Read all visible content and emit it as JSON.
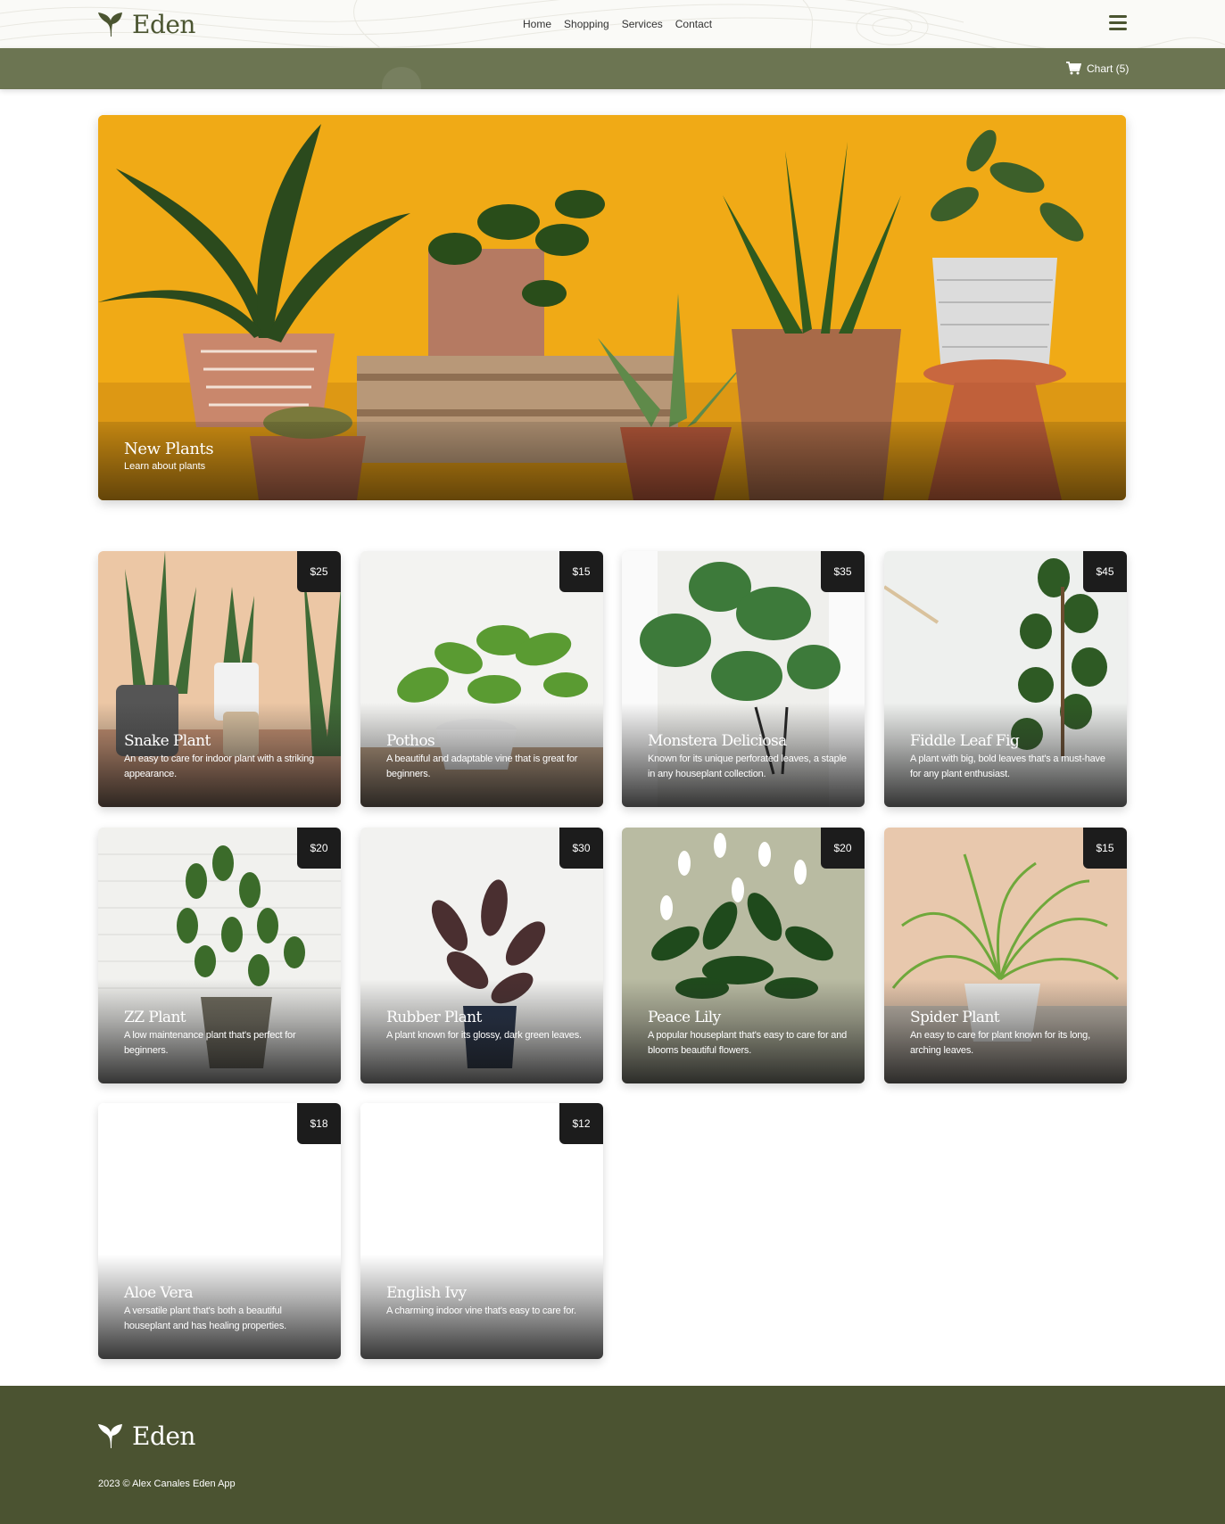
{
  "brand": {
    "name": "Eden"
  },
  "nav": {
    "items": [
      {
        "label": "Home"
      },
      {
        "label": "Shopping"
      },
      {
        "label": "Services"
      },
      {
        "label": "Contact"
      }
    ]
  },
  "cart": {
    "label": "Chart (5)"
  },
  "hero": {
    "title": "New Plants",
    "subtitle": "Learn about plants"
  },
  "products": [
    {
      "name": "Snake Plant",
      "price": "$25",
      "description": "An easy to care for indoor plant with a striking appearance."
    },
    {
      "name": "Pothos",
      "price": "$15",
      "description": "A beautiful and adaptable vine that is great for beginners."
    },
    {
      "name": "Monstera Deliciosa",
      "price": "$35",
      "description": "Known for its unique perforated leaves, a staple in any houseplant collection."
    },
    {
      "name": "Fiddle Leaf Fig",
      "price": "$45",
      "description": "A plant with big, bold leaves that's a must-have for any plant enthusiast."
    },
    {
      "name": "ZZ Plant",
      "price": "$20",
      "description": "A low maintenance plant that's perfect for beginners."
    },
    {
      "name": "Rubber Plant",
      "price": "$30",
      "description": "A plant known for its glossy, dark green leaves."
    },
    {
      "name": "Peace Lily",
      "price": "$20",
      "description": "A popular houseplant that's easy to care for and blooms beautiful flowers."
    },
    {
      "name": "Spider Plant",
      "price": "$15",
      "description": "An easy to care for plant known for its long, arching leaves."
    },
    {
      "name": "Aloe Vera",
      "price": "$18",
      "description": "A versatile plant that's both a beautiful houseplant and has healing properties."
    },
    {
      "name": "English Ivy",
      "price": "$12",
      "description": "A charming indoor vine that's easy to care for."
    }
  ],
  "footer": {
    "brand": "Eden",
    "copyright": "2023 © Alex Canales Eden App"
  },
  "colors": {
    "brand": "#4b5531",
    "subbar": "#6c7552",
    "footer": "#4b5331",
    "price_badge": "#1c1c1c",
    "hero_bg": "#f0aa16"
  }
}
